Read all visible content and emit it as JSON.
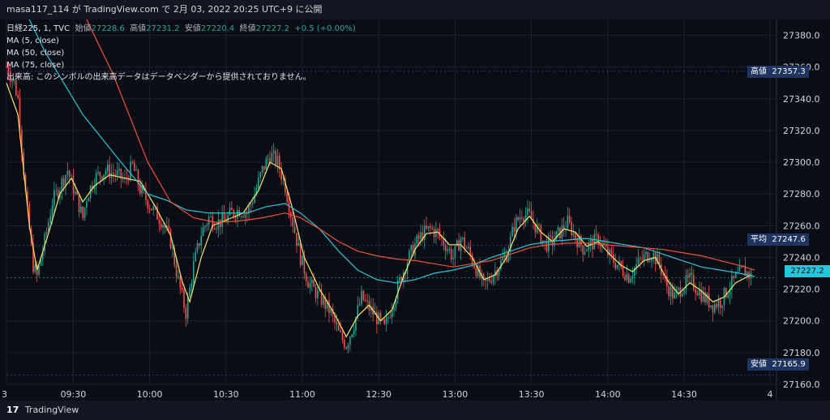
{
  "header": {
    "text": "masa117_114 が TradingView.com で 2月 03, 2022 20:25 UTC+9 に公開"
  },
  "legend": {
    "symbol": "日経225, 1, TVC",
    "open_label": "始値",
    "open": "27228.6",
    "high_label": "高値",
    "high": "27231.2",
    "low_label": "安値",
    "low": "27220.4",
    "close_label": "終値",
    "close": "27227.2",
    "change": "+0.5 (+0.00%)",
    "ma1": "MA (5, close)",
    "ma2": "MA (50, close)",
    "ma3": "MA (75, close)",
    "volume_note": "出来高: このシンボルの出来高データはデータベンダーから提供されておりません。"
  },
  "price_tags": {
    "high_label": "高値",
    "high_value": "27357.3",
    "avg_label": "平均",
    "avg_value": "27247.6",
    "low_label": "安値",
    "low_value": "27165.9",
    "last_value": "27227.2"
  },
  "footer": {
    "logo": "17",
    "text": "TradingView"
  },
  "colors": {
    "up": "#26a69a",
    "down": "#ef5350",
    "ma5": "#f5e663",
    "ma50": "#26c6da",
    "ma75": "#f0513a",
    "grid": "#1c2030",
    "last": "#26c6da"
  },
  "chart_data": {
    "type": "candlestick",
    "title": "日経225, 1, TVC",
    "ylim": [
      27160,
      27390
    ],
    "y_ticks": [
      27160,
      27180,
      27200,
      27220,
      27240,
      27260,
      27280,
      27300,
      27320,
      27340,
      27360,
      27380
    ],
    "y_tick_labels": [
      "27160.0",
      "27180.0",
      "27200.0",
      "27220.0",
      "27240.0",
      "27260.0",
      "27280.0",
      "27300.0",
      "27320.0",
      "27340.0",
      "27360.0",
      "27380.0"
    ],
    "x_tick_labels": [
      "3",
      "09:30",
      "10:00",
      "10:30",
      "11:00",
      "12:30",
      "13:00",
      "13:30",
      "14:00",
      "14:30",
      "4"
    ],
    "x_tick_positions": [
      0,
      17.5,
      37.5,
      57.5,
      77.5,
      97.5,
      117.5,
      137.5,
      157.5,
      177.5,
      200
    ],
    "x_range": [
      0,
      200
    ],
    "close_path": [
      [
        0,
        27360
      ],
      [
        2,
        27350
      ],
      [
        3,
        27340
      ],
      [
        5,
        27280
      ],
      [
        7,
        27235
      ],
      [
        8,
        27228
      ],
      [
        10,
        27250
      ],
      [
        12,
        27275
      ],
      [
        14,
        27285
      ],
      [
        16,
        27295
      ],
      [
        18,
        27280
      ],
      [
        20,
        27265
      ],
      [
        21,
        27278
      ],
      [
        23,
        27290
      ],
      [
        26,
        27295
      ],
      [
        29,
        27292
      ],
      [
        31,
        27288
      ],
      [
        33,
        27298
      ],
      [
        35,
        27283
      ],
      [
        37,
        27275
      ],
      [
        39,
        27268
      ],
      [
        41,
        27262
      ],
      [
        43,
        27250
      ],
      [
        45,
        27225
      ],
      [
        47,
        27205
      ],
      [
        49,
        27235
      ],
      [
        51,
        27255
      ],
      [
        53,
        27265
      ],
      [
        55,
        27262
      ],
      [
        57,
        27263
      ],
      [
        59,
        27268
      ],
      [
        61,
        27270
      ],
      [
        63,
        27268
      ],
      [
        65,
        27280
      ],
      [
        67,
        27295
      ],
      [
        69,
        27305
      ],
      [
        71,
        27300
      ],
      [
        73,
        27285
      ],
      [
        75,
        27262
      ],
      [
        77,
        27240
      ],
      [
        79,
        27225
      ],
      [
        81,
        27218
      ],
      [
        83,
        27212
      ],
      [
        85,
        27205
      ],
      [
        87,
        27192
      ],
      [
        89,
        27185
      ],
      [
        91,
        27198
      ],
      [
        93,
        27215
      ],
      [
        95,
        27208
      ],
      [
        97,
        27202
      ],
      [
        99,
        27195
      ],
      [
        101,
        27210
      ],
      [
        103,
        27225
      ],
      [
        105,
        27238
      ],
      [
        107,
        27248
      ],
      [
        109,
        27255
      ],
      [
        111,
        27258
      ],
      [
        113,
        27255
      ],
      [
        115,
        27248
      ],
      [
        117,
        27240
      ],
      [
        119,
        27252
      ],
      [
        121,
        27244
      ],
      [
        123,
        27233
      ],
      [
        125,
        27222
      ],
      [
        127,
        27228
      ],
      [
        129,
        27235
      ],
      [
        131,
        27242
      ],
      [
        133,
        27260
      ],
      [
        135,
        27268
      ],
      [
        137,
        27266
      ],
      [
        139,
        27258
      ],
      [
        141,
        27248
      ],
      [
        143,
        27250
      ],
      [
        145,
        27256
      ],
      [
        147,
        27262
      ],
      [
        149,
        27253
      ],
      [
        151,
        27246
      ],
      [
        153,
        27248
      ],
      [
        155,
        27252
      ],
      [
        157,
        27244
      ],
      [
        159,
        27238
      ],
      [
        161,
        27233
      ],
      [
        163,
        27228
      ],
      [
        165,
        27235
      ],
      [
        167,
        27240
      ],
      [
        169,
        27243
      ],
      [
        171,
        27236
      ],
      [
        173,
        27222
      ],
      [
        175,
        27215
      ],
      [
        177,
        27222
      ],
      [
        179,
        27226
      ],
      [
        181,
        27220
      ],
      [
        183,
        27214
      ],
      [
        185,
        27210
      ],
      [
        187,
        27212
      ],
      [
        189,
        27220
      ],
      [
        191,
        27227
      ],
      [
        193,
        27232
      ],
      [
        195,
        27228
      ]
    ],
    "series": [
      {
        "name": "MA (5, close)",
        "points": [
          [
            0,
            27350
          ],
          [
            3,
            27330
          ],
          [
            6,
            27260
          ],
          [
            8,
            27232
          ],
          [
            11,
            27255
          ],
          [
            14,
            27280
          ],
          [
            17,
            27290
          ],
          [
            20,
            27275
          ],
          [
            23,
            27285
          ],
          [
            27,
            27292
          ],
          [
            31,
            27290
          ],
          [
            35,
            27288
          ],
          [
            39,
            27272
          ],
          [
            43,
            27254
          ],
          [
            46,
            27225
          ],
          [
            48,
            27212
          ],
          [
            51,
            27240
          ],
          [
            54,
            27260
          ],
          [
            58,
            27264
          ],
          [
            62,
            27268
          ],
          [
            66,
            27282
          ],
          [
            69,
            27300
          ],
          [
            72,
            27296
          ],
          [
            75,
            27270
          ],
          [
            78,
            27240
          ],
          [
            82,
            27220
          ],
          [
            86,
            27204
          ],
          [
            89,
            27190
          ],
          [
            92,
            27203
          ],
          [
            95,
            27210
          ],
          [
            98,
            27200
          ],
          [
            101,
            27207
          ],
          [
            104,
            27228
          ],
          [
            107,
            27245
          ],
          [
            110,
            27255
          ],
          [
            113,
            27256
          ],
          [
            116,
            27248
          ],
          [
            119,
            27248
          ],
          [
            122,
            27240
          ],
          [
            125,
            27226
          ],
          [
            128,
            27229
          ],
          [
            131,
            27240
          ],
          [
            134,
            27258
          ],
          [
            137,
            27266
          ],
          [
            140,
            27256
          ],
          [
            143,
            27250
          ],
          [
            146,
            27258
          ],
          [
            149,
            27256
          ],
          [
            152,
            27247
          ],
          [
            155,
            27250
          ],
          [
            158,
            27242
          ],
          [
            161,
            27235
          ],
          [
            164,
            27231
          ],
          [
            167,
            27238
          ],
          [
            170,
            27240
          ],
          [
            173,
            27226
          ],
          [
            176,
            27217
          ],
          [
            179,
            27224
          ],
          [
            182,
            27219
          ],
          [
            185,
            27212
          ],
          [
            188,
            27215
          ],
          [
            191,
            27224
          ],
          [
            195,
            27229
          ]
        ]
      },
      {
        "name": "MA (50, close)",
        "points": [
          [
            0,
            27420
          ],
          [
            10,
            27370
          ],
          [
            20,
            27330
          ],
          [
            30,
            27300
          ],
          [
            37,
            27280
          ],
          [
            42,
            27276
          ],
          [
            47,
            27270
          ],
          [
            53,
            27268
          ],
          [
            58,
            27268
          ],
          [
            63,
            27268
          ],
          [
            68,
            27272
          ],
          [
            73,
            27274
          ],
          [
            77,
            27268
          ],
          [
            82,
            27258
          ],
          [
            87,
            27244
          ],
          [
            92,
            27232
          ],
          [
            97,
            27226
          ],
          [
            102,
            27224
          ],
          [
            107,
            27226
          ],
          [
            112,
            27230
          ],
          [
            117,
            27232
          ],
          [
            122,
            27235
          ],
          [
            127,
            27240
          ],
          [
            132,
            27244
          ],
          [
            137,
            27248
          ],
          [
            142,
            27250
          ],
          [
            147,
            27251
          ],
          [
            152,
            27252
          ],
          [
            157,
            27250
          ],
          [
            162,
            27248
          ],
          [
            167,
            27246
          ],
          [
            172,
            27242
          ],
          [
            177,
            27238
          ],
          [
            182,
            27234
          ],
          [
            187,
            27232
          ],
          [
            192,
            27230
          ],
          [
            196,
            27228
          ]
        ]
      },
      {
        "name": "MA (75, close)",
        "points": [
          [
            0,
            27480
          ],
          [
            15,
            27420
          ],
          [
            28,
            27355
          ],
          [
            37,
            27300
          ],
          [
            43,
            27275
          ],
          [
            49,
            27265
          ],
          [
            55,
            27262
          ],
          [
            61,
            27263
          ],
          [
            67,
            27265
          ],
          [
            73,
            27268
          ],
          [
            77,
            27265
          ],
          [
            82,
            27258
          ],
          [
            87,
            27250
          ],
          [
            92,
            27244
          ],
          [
            97,
            27241
          ],
          [
            102,
            27239
          ],
          [
            107,
            27238
          ],
          [
            112,
            27236
          ],
          [
            117,
            27234
          ],
          [
            122,
            27236
          ],
          [
            127,
            27238
          ],
          [
            132,
            27242
          ],
          [
            137,
            27246
          ],
          [
            142,
            27248
          ],
          [
            147,
            27249
          ],
          [
            152,
            27249
          ],
          [
            157,
            27248
          ],
          [
            162,
            27247
          ],
          [
            167,
            27246
          ],
          [
            172,
            27245
          ],
          [
            177,
            27243
          ],
          [
            182,
            27241
          ],
          [
            187,
            27238
          ],
          [
            192,
            27235
          ],
          [
            196,
            27232
          ]
        ]
      }
    ],
    "levels": {
      "high": 27357.3,
      "avg": 27247.6,
      "low": 27165.9,
      "last": 27227.2
    }
  }
}
